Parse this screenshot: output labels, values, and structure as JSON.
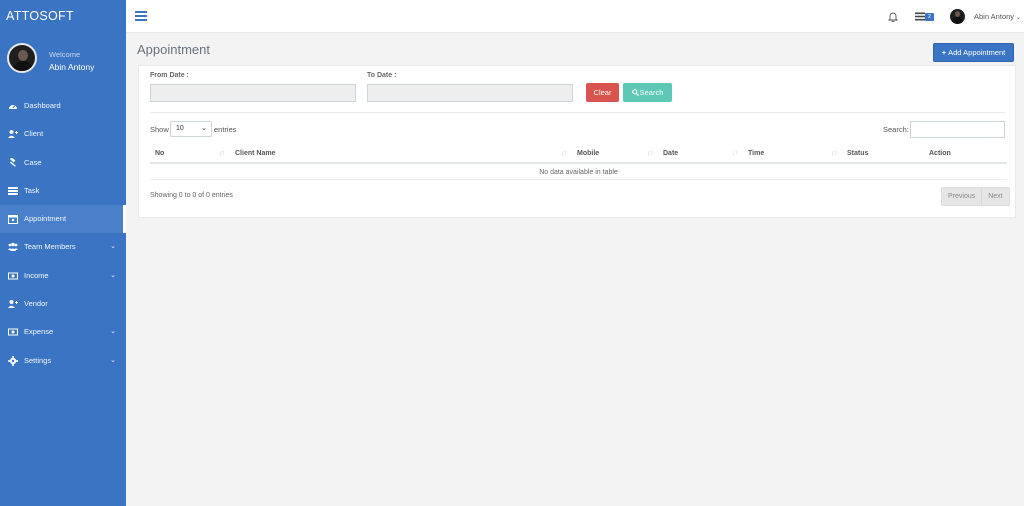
{
  "sidebar": {
    "brand": "ATTOSOFT",
    "welcome": "Welcome",
    "user_name": "Abin Antony",
    "items": [
      {
        "label": "Dashboard",
        "icon": "dashboard-icon"
      },
      {
        "label": "Client",
        "icon": "user-plus-icon"
      },
      {
        "label": "Case",
        "icon": "gavel-icon"
      },
      {
        "label": "Task",
        "icon": "server-icon"
      },
      {
        "label": "Appointment",
        "icon": "calendar-icon",
        "active": true
      },
      {
        "label": "Team Members",
        "icon": "users-icon",
        "has_submenu": true
      },
      {
        "label": "Income",
        "icon": "money-icon",
        "has_submenu": true
      },
      {
        "label": "Vendor",
        "icon": "user-plus-icon"
      },
      {
        "label": "Expense",
        "icon": "money-icon",
        "has_submenu": true
      },
      {
        "label": "Settings",
        "icon": "gear-icon",
        "has_submenu": true
      }
    ],
    "chevron": "⌄"
  },
  "topbar": {
    "badge_count": "2",
    "user_name": "Abin Antony",
    "caret": "⌄"
  },
  "page": {
    "title": "Appointment",
    "add_button": "Add Appointment",
    "add_icon": "+"
  },
  "filters": {
    "from_label": "From Date :",
    "to_label": "To Date :",
    "clear_label": "Clear",
    "search_label": "Search"
  },
  "table": {
    "show_label": "Show",
    "entries_value": "10",
    "entries_label": "entries",
    "search_label": "Search:",
    "columns": [
      "No",
      "Client Name",
      "Mobile",
      "Date",
      "Time",
      "Status",
      "Action"
    ],
    "empty_text": "No data available in table",
    "info": "Showing 0 to 0 of 0 entries",
    "prev_label": "Previous",
    "next_label": "Next"
  },
  "colors": {
    "sidebar": "#3b74c3",
    "primary": "#3b74c3",
    "danger": "#d9534f",
    "info": "#5cc8b5"
  }
}
